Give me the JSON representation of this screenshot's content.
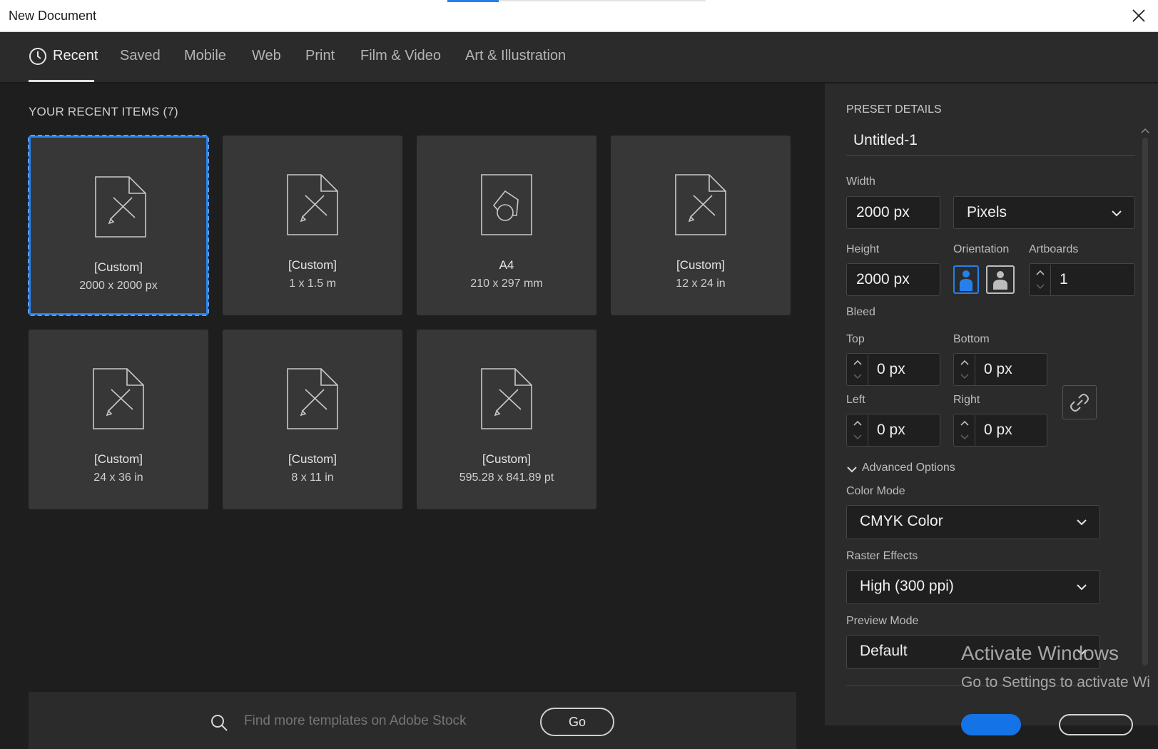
{
  "window": {
    "title": "New Document",
    "close_icon": "close-icon"
  },
  "tabs": [
    {
      "label": "Recent",
      "icon": "clock-icon",
      "active": true
    },
    {
      "label": "Saved"
    },
    {
      "label": "Mobile"
    },
    {
      "label": "Web"
    },
    {
      "label": "Print"
    },
    {
      "label": "Film & Video"
    },
    {
      "label": "Art & Illustration"
    }
  ],
  "recent": {
    "title": "YOUR RECENT ITEMS",
    "count": "(7)",
    "items": [
      {
        "name": "[Custom]",
        "dims": "2000 x 2000 px",
        "icon": "custom-document-icon"
      },
      {
        "name": "[Custom]",
        "dims": "1 x 1.5 m",
        "icon": "custom-document-icon"
      },
      {
        "name": "A4",
        "dims": "210 x 297 mm",
        "icon": "print-document-icon"
      },
      {
        "name": "[Custom]",
        "dims": "12 x 24 in",
        "icon": "custom-document-icon"
      },
      {
        "name": "[Custom]",
        "dims": "24 x 36 in",
        "icon": "custom-document-icon"
      },
      {
        "name": "[Custom]",
        "dims": "8 x 11 in",
        "icon": "custom-document-icon"
      },
      {
        "name": "[Custom]",
        "dims": "595.28 x 841.89 pt",
        "icon": "custom-document-icon"
      }
    ]
  },
  "stock": {
    "placeholder": "Find more templates on Adobe Stock",
    "go_label": "Go"
  },
  "preset": {
    "heading": "PRESET DETAILS",
    "name": "Untitled-1",
    "width_label": "Width",
    "width_value": "2000 px",
    "units": "Pixels",
    "height_label": "Height",
    "height_value": "2000 px",
    "orientation_label": "Orientation",
    "artboards_label": "Artboards",
    "artboards_value": "1",
    "bleed_label": "Bleed",
    "top_label": "Top",
    "top_value": "0 px",
    "bottom_label": "Bottom",
    "bottom_value": "0 px",
    "left_label": "Left",
    "left_value": "0 px",
    "right_label": "Right",
    "right_value": "0 px",
    "advanced_label": "Advanced Options",
    "color_mode_label": "Color Mode",
    "color_mode_value": "CMYK Color",
    "raster_label": "Raster Effects",
    "raster_value": "High (300 ppi)",
    "preview_label": "Preview Mode",
    "preview_value": "Default"
  },
  "watermark": {
    "line1": "Activate Windows",
    "line2": "Go to Settings to activate Wi"
  },
  "colors": {
    "accent": "#2680eb",
    "panel": "#2b2b2b",
    "background": "#1e1e1e",
    "card": "#373737"
  }
}
